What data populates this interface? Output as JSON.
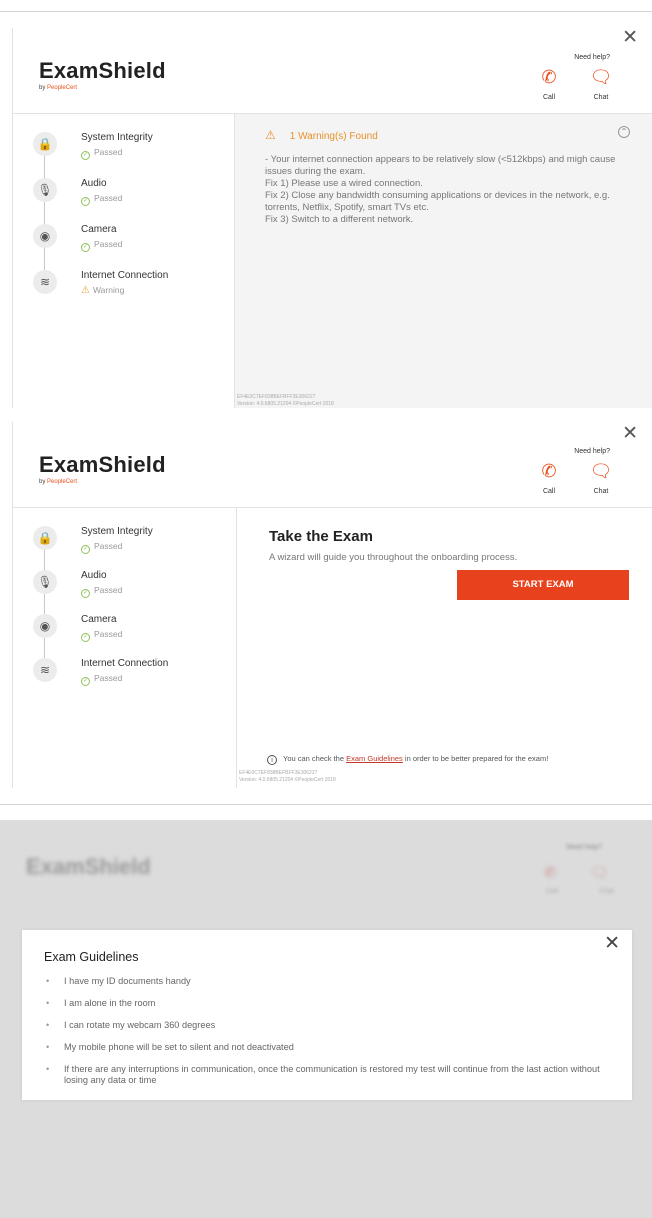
{
  "logo": {
    "name": "ExamShield",
    "by": "by ",
    "brand": "PeopleCert"
  },
  "help": {
    "title": "Need help?",
    "call": "Call",
    "chat": "Chat",
    "call_icon": "phone-icon",
    "chat_icon": "chat-bubble-icon"
  },
  "checks": [
    {
      "name": "System Integrity",
      "status": "Passed",
      "icon": "lock-icon"
    },
    {
      "name": "Audio",
      "status": "Passed",
      "icon": "microphone-icon"
    },
    {
      "name": "Camera",
      "status": "Passed",
      "icon": "webcam-icon"
    },
    {
      "name": "Internet Connection",
      "status": "Warning",
      "icon": "wifi-icon"
    }
  ],
  "checks2": [
    {
      "name": "System Integrity",
      "status": "Passed"
    },
    {
      "name": "Audio",
      "status": "Passed"
    },
    {
      "name": "Camera",
      "status": "Passed"
    },
    {
      "name": "Internet Connection",
      "status": "Passed"
    }
  ],
  "warning": {
    "title": "1 Warning(s) Found",
    "lines": [
      " - Your internet connection appears to be relatively slow (<512kbps) and migh cause issues during the exam.",
      "Fix 1) Please use a wired connection.",
      "Fix 2) Close any bandwidth consuming applications or devices in the network, e.g. torrents, Netflix, Spotify, smart TVs etc.",
      "Fix 3) Switch to a different network."
    ]
  },
  "footer": {
    "line1": "EF4E0C7EF838BEFBFF3E306227",
    "line2": "Version: 4.0.6805.21204 ©PeopleCert 2018"
  },
  "exam": {
    "title": "Take the Exam",
    "description": "A wizard will guide you throughout the onboarding process.",
    "start_label": "START EXAM",
    "note_prefix": "You can check the ",
    "note_link": "Exam Guidelines",
    "note_suffix": " in order to be better prepared for the exam!"
  },
  "guidelines": {
    "title": "Exam Guidelines",
    "items": [
      "I have my ID documents handy",
      "I am alone in the room",
      "I can rotate my webcam 360 degrees",
      "My mobile phone will be set to silent and not deactivated",
      "If there are any interruptions in communication, once the communication is restored my test will continue from the last action without losing any data or time"
    ]
  },
  "colors": {
    "accent": "#e8411d",
    "warning": "#e8912b",
    "passed": "#8dc15a"
  }
}
